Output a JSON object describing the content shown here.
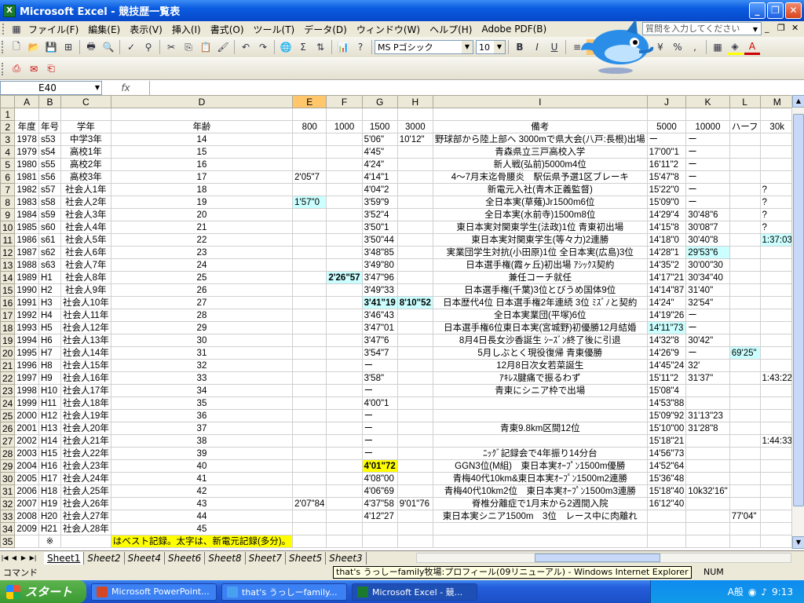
{
  "window": {
    "title": "Microsoft Excel - 競技歴一覧表"
  },
  "menu": [
    "ファイル(F)",
    "編集(E)",
    "表示(V)",
    "挿入(I)",
    "書式(O)",
    "ツール(T)",
    "データ(D)",
    "ウィンドウ(W)",
    "ヘルプ(H)",
    "Adobe PDF(B)"
  ],
  "help_placeholder": "質問を入力してください",
  "toolbar": {
    "font": "MS Pゴシック",
    "size": "10"
  },
  "namebox": "E40",
  "columns": [
    "A",
    "B",
    "C",
    "D",
    "E",
    "F",
    "G",
    "H",
    "I",
    "J",
    "K",
    "L",
    "M"
  ],
  "selected_column": "E",
  "rows": [
    [
      "",
      "",
      "",
      "",
      "",
      "",
      "",
      "",
      "",
      "",
      "",
      "",
      ""
    ],
    [
      "年度",
      "年号",
      "学年",
      "年齢",
      "800",
      "1000",
      "1500",
      "3000",
      "備考",
      "5000",
      "10000",
      "ハーフ",
      "30k"
    ],
    [
      "1978",
      "s53",
      "中学3年",
      "14",
      "",
      "",
      "5'06\"",
      "10'12\"",
      "野球部から陸上部へ 3000mで県大会(八戸:長根)出場",
      "ー",
      "ー",
      "",
      ""
    ],
    [
      "1979",
      "s54",
      "高校1年",
      "15",
      "",
      "",
      "4'45\"",
      "",
      "青森県立三戸高校入学",
      "17'00\"1",
      "ー",
      "",
      ""
    ],
    [
      "1980",
      "s55",
      "高校2年",
      "16",
      "",
      "",
      "4'24\"",
      "",
      "新人戦(弘前)5000m4位",
      "16'11\"2",
      "ー",
      "",
      ""
    ],
    [
      "1981",
      "s56",
      "高校3年",
      "17",
      "2'05\"7",
      "",
      "4'14\"1",
      "",
      "4～7月末迄骨腰炎　駅伝県予選1区ブレーキ",
      "15'47\"8",
      "ー",
      "",
      ""
    ],
    [
      "1982",
      "s57",
      "社会人1年",
      "18",
      "",
      "",
      "4'04\"2",
      "",
      "新電元入社(青木正義監督)",
      "15'22\"0",
      "ー",
      "",
      "?"
    ],
    [
      "1983",
      "s58",
      "社会人2年",
      "19",
      "1'57\"0",
      "",
      "3'59\"9",
      "",
      "全日本実(草薙)Jr1500m6位",
      "15'09\"0",
      "ー",
      "",
      "?"
    ],
    [
      "1984",
      "s59",
      "社会人3年",
      "20",
      "",
      "",
      "3'52\"4",
      "",
      "全日本実(水前寺)1500m8位",
      "14'29\"4",
      "30'48\"6",
      "",
      "?"
    ],
    [
      "1985",
      "s60",
      "社会人4年",
      "21",
      "",
      "",
      "3'50\"1",
      "",
      "東日本実対関東学生(法政)1位 青東初出場",
      "14'15\"8",
      "30'08\"7",
      "",
      "?"
    ],
    [
      "1986",
      "s61",
      "社会人5年",
      "22",
      "",
      "",
      "3'50\"44",
      "",
      "東日本実対関東学生(等々力)2連勝",
      "14'18\"0",
      "30'40\"8",
      "",
      "1:37:03"
    ],
    [
      "1987",
      "s62",
      "社会人6年",
      "23",
      "",
      "",
      "3'48\"85",
      "",
      "実業団学生対抗(小田原)1位 全日本実(広島)3位",
      "14'28\"1",
      "29'53\"6",
      "",
      ""
    ],
    [
      "1988",
      "s63",
      "社会人7年",
      "24",
      "",
      "",
      "3'49\"80",
      "",
      "日本選手権(霞ヶ丘)初出場 ｱｼｯｸｽ契約",
      "14'35\"2",
      "30'00\"30",
      "",
      ""
    ],
    [
      "1989",
      "H1",
      "社会人8年",
      "25",
      "",
      "2'26\"57",
      "3'47\"96",
      "",
      "兼任コーチ就任",
      "14'17\"21",
      "30'34\"40",
      "",
      ""
    ],
    [
      "1990",
      "H2",
      "社会人9年",
      "26",
      "",
      "",
      "3'49\"33",
      "",
      "日本選手権(千葉)3位とびうめ国体9位",
      "14'14\"87",
      "31'40\"",
      "",
      ""
    ],
    [
      "1991",
      "H3",
      "社会人10年",
      "27",
      "",
      "",
      "3'41\"19",
      "8'10\"52",
      "日本歴代4位 日本選手権2年連続 3位 ﾐｽﾞﾉと契約",
      "14'24\"",
      "32'54\"",
      "",
      ""
    ],
    [
      "1992",
      "H4",
      "社会人11年",
      "28",
      "",
      "",
      "3'46\"43",
      "",
      "全日本実業団(平塚)6位",
      "14'19\"26",
      "ー",
      "",
      ""
    ],
    [
      "1993",
      "H5",
      "社会人12年",
      "29",
      "",
      "",
      "3'47\"01",
      "",
      "日本選手権6位東日本実(宮城野)初優勝12月結婚",
      "14'11\"73",
      "ー",
      "",
      ""
    ],
    [
      "1994",
      "H6",
      "社会人13年",
      "30",
      "",
      "",
      "3'47\"6",
      "",
      "8月4日長女沙香誕生 ｼｰｽﾞﾝ終了後に引退",
      "14'32\"8",
      "30'42\"",
      "",
      ""
    ],
    [
      "1995",
      "H7",
      "社会人14年",
      "31",
      "",
      "",
      "3'54\"7",
      "",
      "5月しぶとく現役復帰 青東優勝",
      "14'26\"9",
      "ー",
      "69'25\"",
      ""
    ],
    [
      "1996",
      "H8",
      "社会人15年",
      "32",
      "",
      "",
      "ー",
      "",
      "12月8日次女若菜誕生",
      "14'45\"24",
      "32'",
      "",
      ""
    ],
    [
      "1997",
      "H9",
      "社会人16年",
      "33",
      "",
      "",
      "3'58\"",
      "",
      "ｱｷﾚｽ腱痛で振るわず",
      "15'11\"2",
      "31'37\"",
      "",
      "1:43:22"
    ],
    [
      "1998",
      "H10",
      "社会人17年",
      "34",
      "",
      "",
      "ー",
      "",
      "青東にシニア枠で出場",
      "15'08\"4",
      "",
      "",
      ""
    ],
    [
      "1999",
      "H11",
      "社会人18年",
      "35",
      "",
      "",
      "4'00\"1",
      "",
      "",
      "14'53\"88",
      "",
      "",
      ""
    ],
    [
      "2000",
      "H12",
      "社会人19年",
      "36",
      "",
      "",
      "ー",
      "",
      "",
      "15'09\"92",
      "31'13\"23",
      "",
      ""
    ],
    [
      "2001",
      "H13",
      "社会人20年",
      "37",
      "",
      "",
      "ー",
      "",
      "青東9.8km区間12位",
      "15'10\"00",
      "31'28\"8",
      "",
      ""
    ],
    [
      "2002",
      "H14",
      "社会人21年",
      "38",
      "",
      "",
      "ー",
      "",
      "",
      "15'18\"21",
      "",
      "",
      "1:44:33"
    ],
    [
      "2003",
      "H15",
      "社会人22年",
      "39",
      "",
      "",
      "ー",
      "",
      "ﾆｯｸﾞ記録会で4年振り14分台",
      "14'56\"73",
      "",
      "",
      ""
    ],
    [
      "2004",
      "H16",
      "社会人23年",
      "40",
      "",
      "",
      "4'01\"72",
      "",
      "GGN3位(M組)　東日本実ｵｰﾌﾟﾝ1500m優勝",
      "14'52\"64",
      "",
      "",
      ""
    ],
    [
      "2005",
      "H17",
      "社会人24年",
      "41",
      "",
      "",
      "4'08\"00",
      "",
      "青梅40代10km&東日本実ｵｰﾌﾟﾝ1500m2連勝",
      "15'36\"48",
      "",
      "",
      ""
    ],
    [
      "2006",
      "H18",
      "社会人25年",
      "42",
      "",
      "",
      "4'06\"69",
      "",
      "青梅40代10km2位　東日本実ｵｰﾌﾟﾝ1500m3連勝",
      "15'18\"40",
      "10k32'16\"",
      "",
      ""
    ],
    [
      "2007",
      "H19",
      "社会人26年",
      "43",
      "2'07\"84",
      "",
      "4'37\"58",
      "9'01\"76",
      "脊椎分離症で1月末から2週間入院",
      "16'12\"40",
      "",
      "",
      ""
    ],
    [
      "2008",
      "H20",
      "社会人27年",
      "44",
      "",
      "",
      "4'12\"27",
      "",
      "東日本実シニア1500m　3位　レース中に肉離れ",
      "",
      "",
      "77'04\"",
      ""
    ],
    [
      "2009",
      "H21",
      "社会人28年",
      "45",
      "",
      "",
      "",
      "",
      "",
      "",
      "",
      "",
      ""
    ],
    [
      "",
      "※",
      "",
      "はベスト記録。太字は、新電元記録(多分)。",
      "",
      "",
      "",
      "",
      "",
      "",
      "",
      "",
      ""
    ]
  ],
  "sheet_tabs": [
    "Sheet1",
    "Sheet2",
    "Sheet4",
    "Sheet6",
    "Sheet8",
    "Sheet7",
    "Sheet5",
    "Sheet3"
  ],
  "status": {
    "mode": "コマンド",
    "num": "NUM"
  },
  "tooltip": "that's うっしーfamily牧場:プロフィール(09リニューアル) - Windows Internet Explorer",
  "taskbar": {
    "start": "スタート",
    "items": [
      "Microsoft PowerPoint...",
      "that's うっしーfamily...",
      "Microsoft Excel - 競..."
    ],
    "clock": "9:13",
    "ime": "A般"
  },
  "colors": {
    "highlight_best": "#ccffff",
    "highlight_yellow": "#ffff00",
    "title_blue": "#0a5be0",
    "selected_header": "#ffc66b"
  }
}
